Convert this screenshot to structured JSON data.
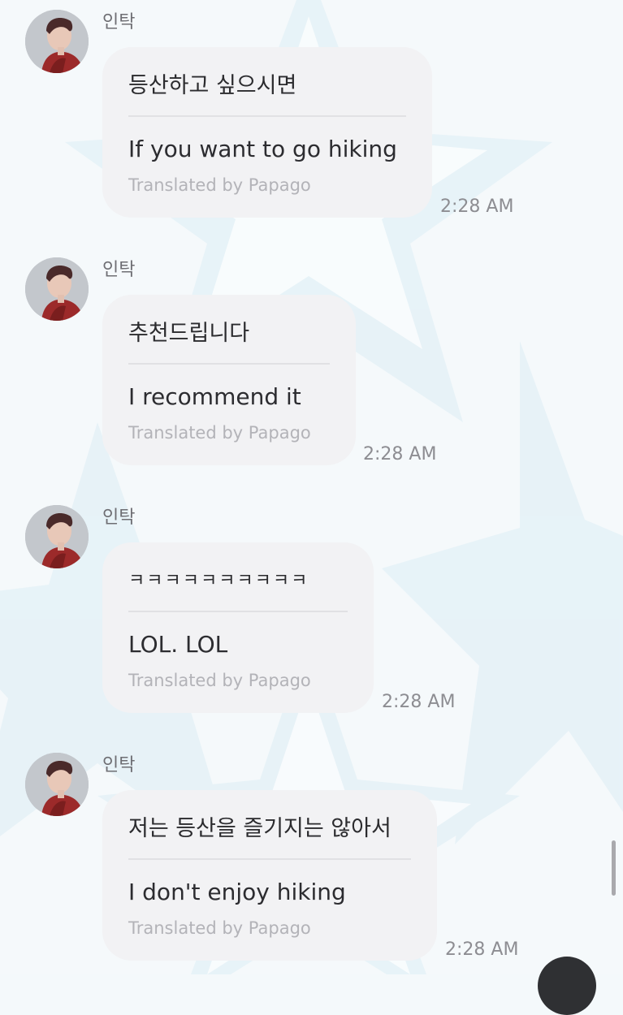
{
  "chat": {
    "messages": [
      {
        "sender": "인탁",
        "original": "등산하고 싶으시면",
        "translation": "If you want to go hiking",
        "credit": "Translated by Papago",
        "time": "2:28 AM"
      },
      {
        "sender": "인탁",
        "original": "추천드립니다",
        "translation": "I recommend it",
        "credit": "Translated by Papago",
        "time": "2:28 AM"
      },
      {
        "sender": "인탁",
        "original": "ㅋㅋㅋㅋㅋㅋㅋㅋㅋㅋ",
        "translation": "LOL. LOL",
        "credit": "Translated by Papago",
        "time": "2:28 AM"
      },
      {
        "sender": "인탁",
        "original": "저는 등산을 즐기지는 않아서",
        "translation": "I don't enjoy hiking",
        "credit": "Translated by Papago",
        "time": "2:28 AM"
      }
    ]
  },
  "colors": {
    "background": "#f4f9fb",
    "bubble": "#f2f2f4",
    "timestamp": "#8d8d92",
    "credit": "#b3b3b8"
  }
}
